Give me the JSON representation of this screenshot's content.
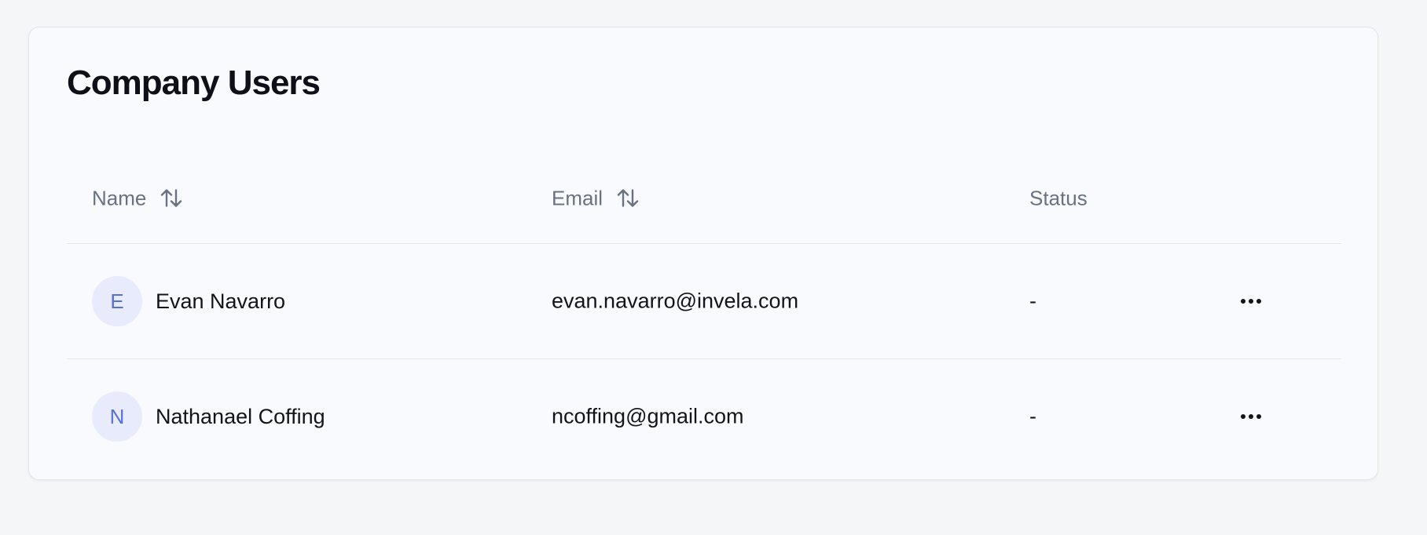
{
  "page": {
    "title": "Company Users"
  },
  "table": {
    "columns": [
      {
        "label": "Name",
        "sortable": true,
        "icon": "sort-arrows-icon"
      },
      {
        "label": "Email",
        "sortable": true,
        "icon": "sort-arrows-icon"
      },
      {
        "label": "Status",
        "sortable": false
      }
    ],
    "rows": [
      {
        "initial": "E",
        "name": "Evan Navarro",
        "email": "evan.navarro@invela.com",
        "status": "-",
        "action_icon": "more-horizontal-icon"
      },
      {
        "initial": "N",
        "name": "Nathanael Coffing",
        "email": "ncoffing@gmail.com",
        "status": "-",
        "action_icon": "more-horizontal-icon"
      }
    ]
  },
  "colors": {
    "background": "#f5f6f8",
    "card": "#f9fafe",
    "avatar_bg": "#e7ebfb",
    "avatar_text": "#5870d8",
    "header_text": "#687282"
  }
}
